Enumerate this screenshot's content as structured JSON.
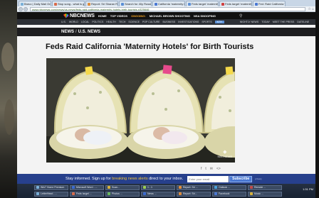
{
  "browser": {
    "tabs": [
      {
        "label": "Bravo | Daily Mail Onl",
        "color": "#7ab0d8"
      },
      {
        "label": "Stop song - what is go",
        "color": "#d86a4a"
      },
      {
        "label": "Report: Sri Sharan Rise",
        "color": "#e08c3a"
      },
      {
        "label": "Search for 40y Russian",
        "color": "#5a8fd6"
      },
      {
        "label": "California 'maternity h",
        "color": "#4a78d2"
      },
      {
        "label": "Feds target 'maternity h",
        "color": "#5a8fd6"
      },
      {
        "label": "Feds target 'maternity h",
        "color": "#d04040"
      },
      {
        "label": "Fed: Raid California 'm",
        "color": "#4a78d2"
      }
    ],
    "url": "www.nbcnews.com/news/us-news/feds-raid-california-maternity-hotels-birth-tourists-n325646"
  },
  "nbc": {
    "logo": "NBCNEWS",
    "topnav": [
      "HOME",
      "TOP VIDEOS",
      "ONGOING:",
      "MICHAEL BROWN SHOOTING",
      "NSA SNOOPING"
    ],
    "subnav_left": [
      "U.S.",
      "WORLD",
      "LOCAL",
      "POLITICS",
      "HEALTH",
      "TECH",
      "SCIENCE",
      "POP CULTURE",
      "BUSINESS",
      "INVESTIGATIONS",
      "SPORTS"
    ],
    "sub_box": "NTH",
    "subnav_right": [
      "NIGHTLY NEWS",
      "TODAY",
      "MEET THE PRESS",
      "DATELINE"
    ],
    "crumb": {
      "home": "NEWS",
      "section": "U.S. NEWS"
    }
  },
  "article": {
    "headline": "Feds Raid California 'Maternity Hotels' for Birth Tourists",
    "watermark": "NBCNEWS"
  },
  "footer": {
    "msg_start": "Stay informed. Sign up for ",
    "msg_highlight": "breaking news alerts",
    "msg_end": " direct to your inbox.",
    "email_placeholder": "Enter your email",
    "subscribe": "Subscribe",
    "privacy": "privacy"
  },
  "taskbar": {
    "row1": [
      {
        "label": "Win7 Home Premium",
        "color": "#7ab0d8"
      },
      {
        "label": "Microsoft Word - ...",
        "color": "#3a6ad0"
      },
      {
        "label": "Scan...",
        "color": "#d8b23a"
      },
      {
        "label": "1 - 1",
        "color": "#9acd52"
      },
      {
        "label": "Report: Sri ...",
        "color": "#e08c3a"
      },
      {
        "label": "Outlook ...",
        "color": "#4aa0d8"
      },
      {
        "label": "Remote ...",
        "color": "#c04a4a"
      }
    ],
    "row2": [
      {
        "label": "LetterHead - ...",
        "color": "#7ab0d8"
      },
      {
        "label": "Feds target ...",
        "color": "#d86a4a"
      },
      {
        "label": "Photos ...",
        "color": "#6aba5a"
      },
      {
        "label": "News ...",
        "color": "#3a6ad0"
      },
      {
        "label": "Report: Sri...",
        "color": "#e08c3a"
      },
      {
        "label": "Facebook",
        "color": "#4a78d2"
      },
      {
        "label": "Music ...",
        "color": "#d8b23a"
      }
    ],
    "clock": "1:31 PM"
  }
}
